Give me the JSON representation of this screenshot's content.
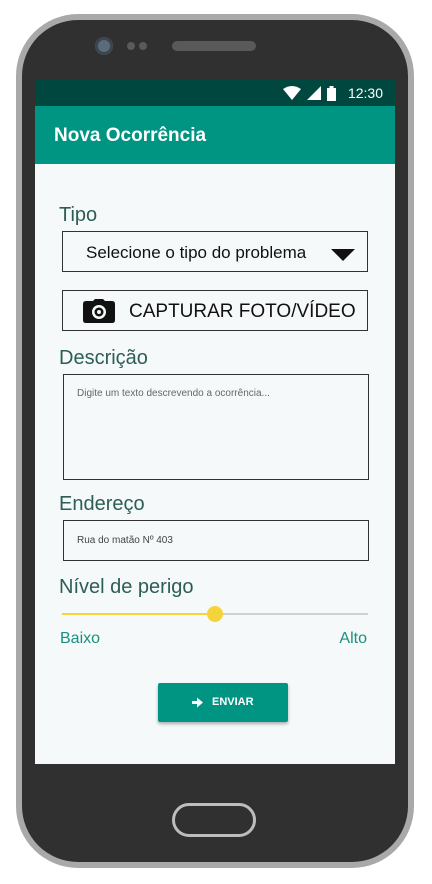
{
  "status_bar": {
    "time": "12:30"
  },
  "app_bar": {
    "title": "Nova Ocorrência"
  },
  "form": {
    "tipo": {
      "label": "Tipo",
      "selected": "Selecione o tipo do problema"
    },
    "capture": {
      "label": "CAPTURAR FOTO/VÍDEO"
    },
    "descricao": {
      "label": "Descrição",
      "placeholder": "Digite um texto descrevendo a ocorrência..."
    },
    "endereco": {
      "label": "Endereço",
      "value": "Rua do matão Nº 403"
    },
    "perigo": {
      "label": "Nível de perigo",
      "low_label": "Baixo",
      "high_label": "Alto",
      "level": 0.5
    },
    "submit": {
      "label": "ENVIAR"
    }
  },
  "icons": {
    "status": [
      "wifi-icon",
      "signal-icon",
      "battery-icon"
    ],
    "capture": "camera-icon",
    "submit": "arrow-right-icon",
    "select": "dropdown-arrow-icon"
  },
  "colors": {
    "status_bar": "#00473f",
    "app_bar": "#009582",
    "accent": "#f5d33a",
    "label": "#2c5e56",
    "range_label": "#1b8f80"
  }
}
